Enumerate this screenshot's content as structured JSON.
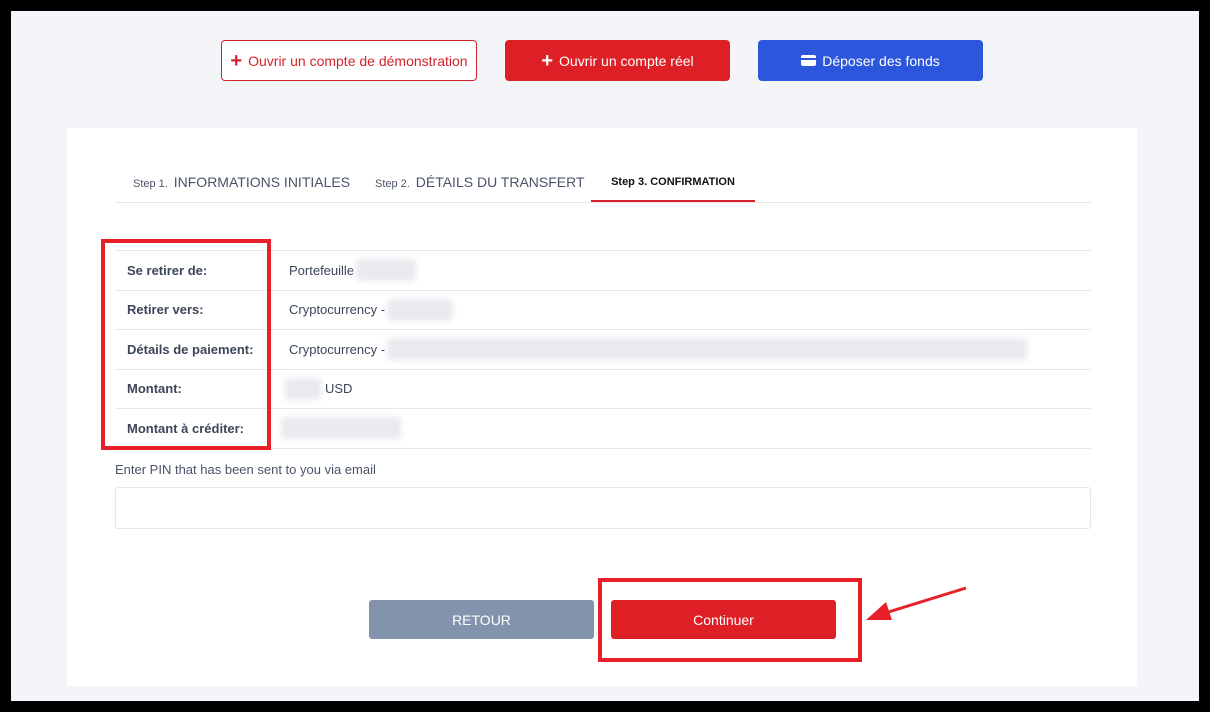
{
  "top_actions": {
    "demo_label": "Ouvrir un compte de démonstration",
    "real_label": "Ouvrir un compte réel",
    "deposit_label": "Déposer des fonds",
    "plus_icon": "+"
  },
  "tabs": [
    {
      "step": "Step 1.",
      "label": "INFORMATIONS INITIALES"
    },
    {
      "step": "Step 2.",
      "label": "DÉTAILS DU TRANSFERT"
    },
    {
      "step": "Step 3.",
      "label": "CONFIRMATION"
    }
  ],
  "details": {
    "rows": [
      {
        "label": "Se retirer de:",
        "value": "Portefeuille"
      },
      {
        "label": "Retirer vers:",
        "value": "Cryptocurrency -"
      },
      {
        "label": "Détails de paiement:",
        "value": "Cryptocurrency -"
      },
      {
        "label": "Montant:",
        "value": "USD"
      },
      {
        "label": "Montant à créditer:",
        "value": ""
      }
    ]
  },
  "pin": {
    "label": "Enter PIN that has been sent to you via email",
    "value": ""
  },
  "buttons": {
    "back_label": "RETOUR",
    "continue_label": "Continuer"
  },
  "colors": {
    "brand_red": "#df1f26",
    "deposit_blue": "#2c57dd",
    "back_gray": "#8393ab",
    "annotation_red": "#e8202a"
  }
}
